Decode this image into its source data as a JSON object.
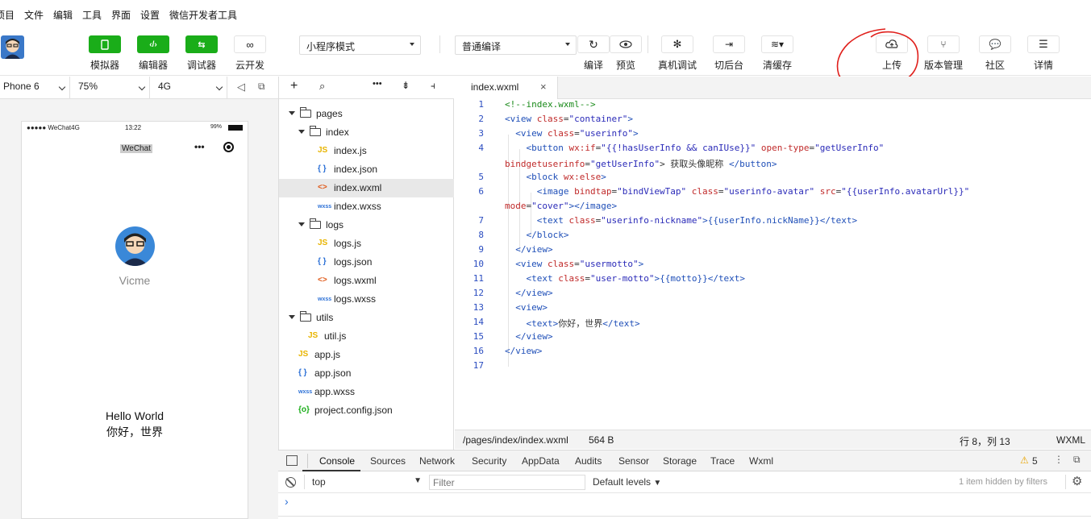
{
  "menu": [
    "项目",
    "文件",
    "编辑",
    "工具",
    "界面",
    "设置",
    "微信开发者工具"
  ],
  "toolbar": {
    "simulator": "模拟器",
    "editor": "编辑器",
    "debugger": "调试器",
    "cloud": "云开发",
    "mode_select": "小程序模式",
    "compile_select": "普通编译",
    "compile": "编译",
    "preview": "预览",
    "remote_debug": "真机调试",
    "background": "切后台",
    "clear_cache": "清缓存",
    "upload": "上传",
    "version": "版本管理",
    "community": "社区",
    "details": "详情"
  },
  "sim_bar": {
    "device": "Phone 6",
    "zoom": "75%",
    "network": "4G"
  },
  "phone": {
    "carrier": "●●●●● WeChat4G",
    "time": "13:22",
    "battery": "99%",
    "nav_title": "WeChat",
    "nickname": "Vicme",
    "hello": "Hello World",
    "greeting": "你好，世界"
  },
  "tree": [
    {
      "name": "pages",
      "kind": "folder",
      "depth": 0
    },
    {
      "name": "index",
      "kind": "folder",
      "depth": 1
    },
    {
      "name": "index.js",
      "kind": "js",
      "depth": 2
    },
    {
      "name": "index.json",
      "kind": "json",
      "depth": 2
    },
    {
      "name": "index.wxml",
      "kind": "wxml",
      "depth": 2,
      "selected": true
    },
    {
      "name": "index.wxss",
      "kind": "wxss",
      "depth": 2
    },
    {
      "name": "logs",
      "kind": "folder",
      "depth": 1
    },
    {
      "name": "logs.js",
      "kind": "js",
      "depth": 2
    },
    {
      "name": "logs.json",
      "kind": "json",
      "depth": 2
    },
    {
      "name": "logs.wxml",
      "kind": "wxml",
      "depth": 2
    },
    {
      "name": "logs.wxss",
      "kind": "wxss",
      "depth": 2
    },
    {
      "name": "utils",
      "kind": "folder",
      "depth": 0
    },
    {
      "name": "util.js",
      "kind": "js",
      "depth": 1
    },
    {
      "name": "app.js",
      "kind": "js",
      "depth": 0
    },
    {
      "name": "app.json",
      "kind": "json",
      "depth": 0
    },
    {
      "name": "app.wxss",
      "kind": "wxss",
      "depth": 0
    },
    {
      "name": "project.config.json",
      "kind": "config",
      "depth": 0
    }
  ],
  "editor": {
    "tab": "index.wxml",
    "line_numbers": [
      "1",
      "2",
      "3",
      "4",
      "",
      "5",
      "6",
      "",
      "7",
      "8",
      "9",
      "10",
      "11",
      "12",
      "13",
      "14",
      "15",
      "16",
      "17"
    ]
  },
  "code": {
    "l1": "<!--index.wxml-->",
    "l2a": "<view ",
    "l2b": "class",
    "l2c": "=",
    "l2d": "\"container\"",
    "l2e": ">",
    "l3a": "  <view ",
    "l3b": "class",
    "l3c": "=",
    "l3d": "\"userinfo\"",
    "l3e": ">",
    "l4a": "    <button ",
    "l4b": "wx:if",
    "l4c": "=",
    "l4d": "\"{{!hasUserInfo && canIUse}}\"",
    "l4e": " open-type",
    "l4f": "=",
    "l4g": "\"getUserInfo\"",
    "l4h": "bindgetuserinfo",
    "l4i": "=",
    "l4j": "\"getUserInfo\"",
    "l4k": "> 获取头像昵称 ",
    "l4l": "</button>",
    "l5a": "    <block ",
    "l5b": "wx:else",
    "l5c": ">",
    "l6a": "      <image ",
    "l6b": "bindtap",
    "l6c": "=",
    "l6d": "\"bindViewTap\"",
    "l6e": " class",
    "l6f": "=",
    "l6g": "\"userinfo-avatar\"",
    "l6h": " src",
    "l6i": "=",
    "l6j": "\"{{userInfo.avatarUrl}}\"",
    "l6k": "mode",
    "l6l": "=",
    "l6m": "\"cover\"",
    "l6n": "></image>",
    "l7a": "      <text ",
    "l7b": "class",
    "l7c": "=",
    "l7d": "\"userinfo-nickname\"",
    "l7e": ">{{userInfo.nickName}}</text>",
    "l8": "    </block>",
    "l9": "  </view>",
    "l10a": "  <view ",
    "l10b": "class",
    "l10c": "=",
    "l10d": "\"usermotto\"",
    "l10e": ">",
    "l11a": "    <text ",
    "l11b": "class",
    "l11c": "=",
    "l11d": "\"user-motto\"",
    "l11e": ">{{motto}}</text>",
    "l12": "  </view>",
    "l13": "  <view>",
    "l14a": "    <text>",
    "l14b": "你好，世界",
    "l14c": "</text>",
    "l15": "  </view>",
    "l16": "</view>"
  },
  "status": {
    "path": "/pages/index/index.wxml",
    "size": "564 B",
    "position": "行 8，列 13",
    "lang": "WXML"
  },
  "devtools": {
    "tabs": [
      "Console",
      "Sources",
      "Network",
      "Security",
      "AppData",
      "Audits",
      "Sensor",
      "Storage",
      "Trace",
      "Wxml"
    ],
    "warnings": "5",
    "context": "top",
    "filter_placeholder": "Filter",
    "levels": "Default levels",
    "hidden": "1 item hidden by filters",
    "prompt": "›"
  },
  "colors": {
    "accent": "#1aad19",
    "annotation": "#e0201c"
  }
}
